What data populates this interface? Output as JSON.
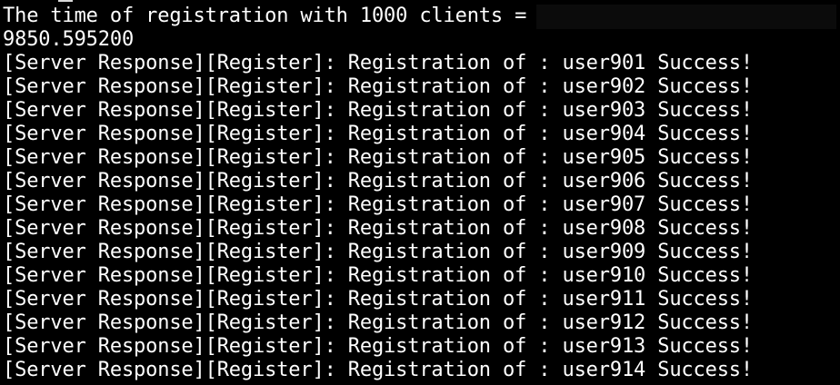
{
  "terminal": {
    "background": "#000000",
    "text_color": "#ffffff",
    "header_line": "The time of registration with 1000 clients =",
    "timing_value": "9850.595200",
    "responses": [
      "[Server Response][Register]: Registration of : user901 Success!",
      "[Server Response][Register]: Registration of : user902 Success!",
      "[Server Response][Register]: Registration of : user903 Success!",
      "[Server Response][Register]: Registration of : user904 Success!",
      "[Server Response][Register]: Registration of : user905 Success!",
      "[Server Response][Register]: Registration of : user906 Success!",
      "[Server Response][Register]: Registration of : user907 Success!",
      "[Server Response][Register]: Registration of : user908 Success!",
      "[Server Response][Register]: Registration of : user909 Success!",
      "[Server Response][Register]: Registration of : user910 Success!",
      "[Server Response][Register]: Registration of : user911 Success!",
      "[Server Response][Register]: Registration of : user912 Success!",
      "[Server Response][Register]: Registration of : user913 Success!",
      "[Server Response][Register]: Registration of : user914 Success!"
    ]
  }
}
